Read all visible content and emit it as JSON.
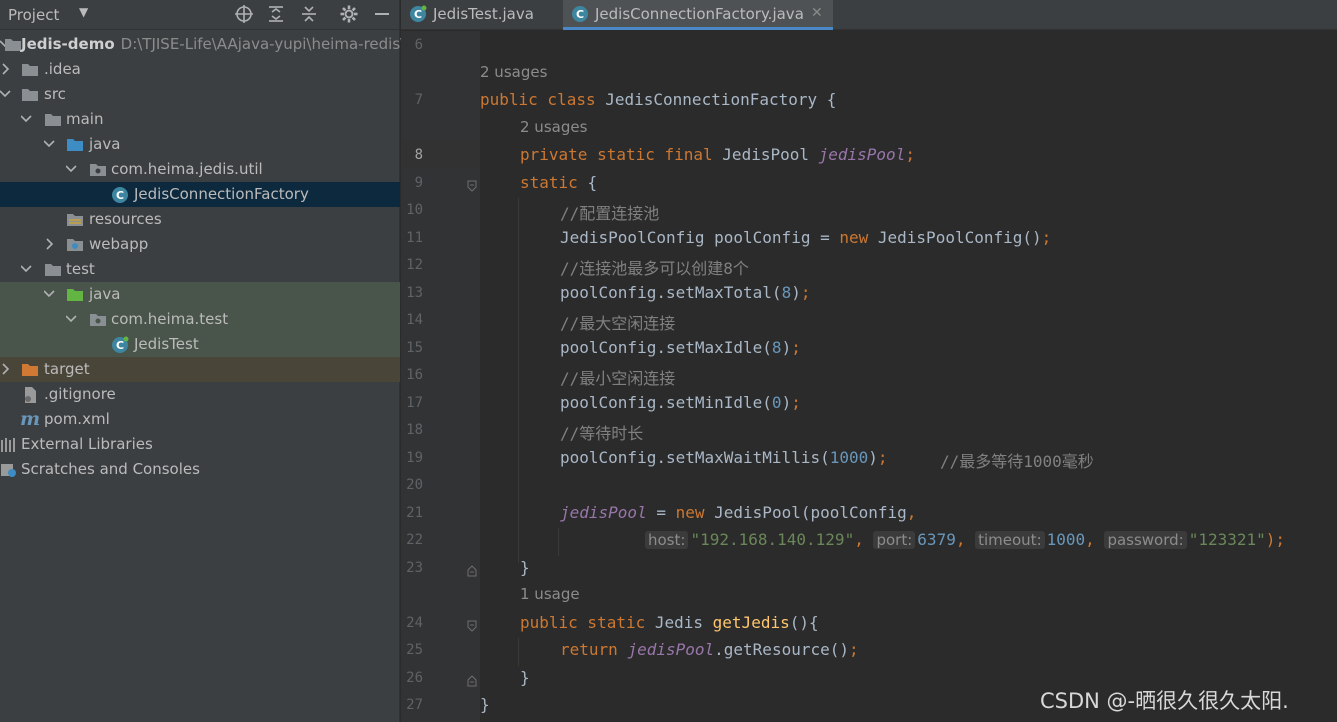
{
  "project_panel": {
    "title": "Project",
    "tree": [
      {
        "label": "Jedis-demo",
        "path": "D:\\TJISE-Life\\AAjava-yupi\\heima-redis\\."
      },
      {
        "label": ".idea"
      },
      {
        "label": "src"
      },
      {
        "label": "main"
      },
      {
        "label": "java"
      },
      {
        "label": "com.heima.jedis.util"
      },
      {
        "label": "JedisConnectionFactory"
      },
      {
        "label": "resources"
      },
      {
        "label": "webapp"
      },
      {
        "label": "test"
      },
      {
        "label": "java"
      },
      {
        "label": "com.heima.test"
      },
      {
        "label": "JedisTest"
      },
      {
        "label": "target"
      },
      {
        "label": ".gitignore"
      },
      {
        "label": "pom.xml"
      },
      {
        "label": "External Libraries"
      },
      {
        "label": "Scratches and Consoles"
      }
    ]
  },
  "editor": {
    "tabs": [
      {
        "label": "JedisTest.java"
      },
      {
        "label": "JedisConnectionFactory.java"
      }
    ],
    "line_numbers": [
      "6",
      "7",
      "8",
      "9",
      "10",
      "11",
      "12",
      "13",
      "14",
      "15",
      "16",
      "17",
      "18",
      "19",
      "20",
      "21",
      "22",
      "23",
      "24",
      "25",
      "26",
      "27"
    ],
    "usages": [
      "2 usages",
      "2 usages",
      "1 usage"
    ],
    "code": {
      "l7_kw": "public class ",
      "l7_rest": "JedisConnectionFactory {",
      "l8_kw": "private static final ",
      "l8_type": "JedisPool ",
      "l8_field": "jedisPool",
      "l8_semi": ";",
      "l9_kw": "static ",
      "l9_rest": "{",
      "l10": "//配置连接池",
      "l11_a": "JedisPoolConfig poolConfig = ",
      "l11_kw": "new ",
      "l11_b": "JedisPoolConfig()",
      "l11_semi": ";",
      "l12": "//连接池最多可以创建8个",
      "l13_a": "poolConfig.setMaxTotal(",
      "l13_num": "8",
      "l13_b": ")",
      "l13_semi": ";",
      "l14": "//最大空闲连接",
      "l15_a": "poolConfig.setMaxIdle(",
      "l15_num": "8",
      "l15_b": ")",
      "l15_semi": ";",
      "l16": "//最小空闲连接",
      "l17_a": "poolConfig.setMinIdle(",
      "l17_num": "0",
      "l17_b": ")",
      "l17_semi": ";",
      "l18": "//等待时长",
      "l19_a": "poolConfig.setMaxWaitMillis(",
      "l19_num": "1000",
      "l19_b": ")",
      "l19_semi": ";",
      "l19_cmt": "//最多等待1000毫秒",
      "l21_field": "jedisPool",
      "l21_a": " = ",
      "l21_kw": "new ",
      "l21_b": "JedisPool(poolConfig",
      "l21_comma": ",",
      "l22_hint_host": "host:",
      "l22_host": "\"192.168.140.129\"",
      "l22_hint_port": "port:",
      "l22_port": "6379",
      "l22_hint_timeout": "timeout:",
      "l22_timeout": "1000",
      "l22_hint_password": "password:",
      "l22_password": "\"123321\"",
      "l22_end": ");",
      "comma": ",",
      "l23": "}",
      "l24_kw": "public static ",
      "l24_type": "Jedis ",
      "l24_fn": "getJedis",
      "l24_rest": "(){",
      "l25_kw": "return ",
      "l25_field": "jedisPool",
      "l25_rest": ".getResource()",
      "l25_semi": ";",
      "l26": "}",
      "l27": "}"
    }
  },
  "watermark": "CSDN @-晒很久很久太阳.",
  "colors": {
    "editor_bg": "#2b2b2b",
    "panel_bg": "#3c3f41",
    "selection": "#0d293e",
    "keyword": "#cc7832",
    "field": "#9876aa",
    "string": "#6a8759",
    "number": "#6897bb",
    "comment": "#808080",
    "function": "#ffc66d"
  }
}
